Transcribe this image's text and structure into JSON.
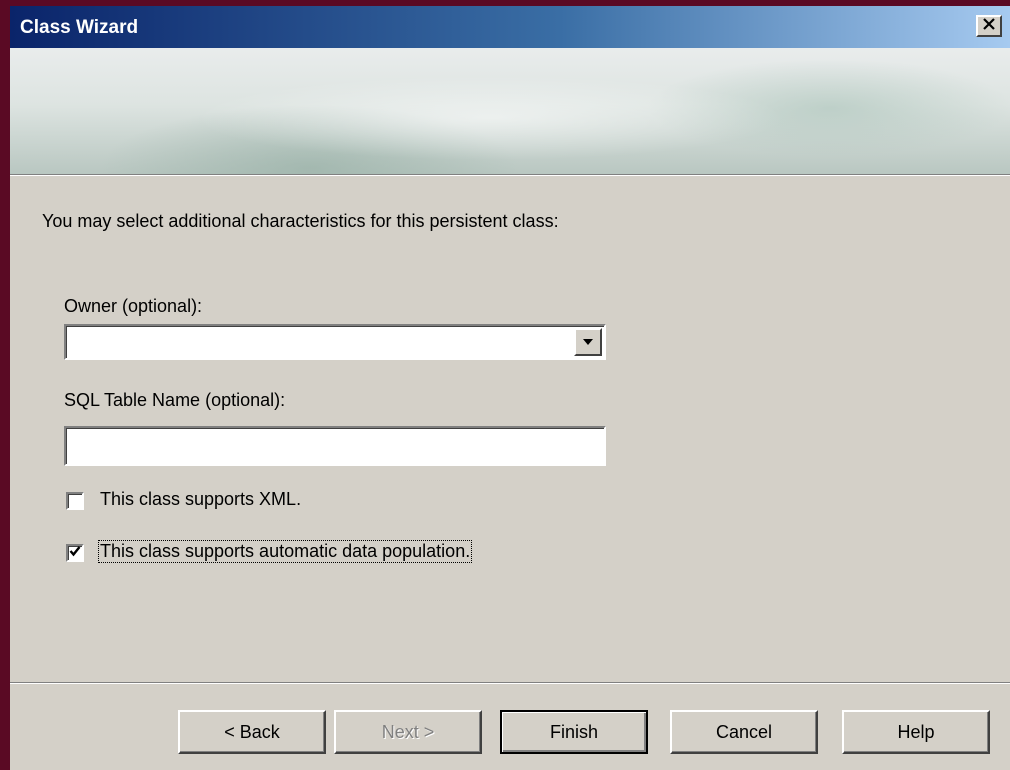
{
  "window": {
    "title": "Class Wizard"
  },
  "intro": "You may select additional characteristics for this persistent class:",
  "owner": {
    "label": "Owner (optional):",
    "value": ""
  },
  "sql_table": {
    "label": "SQL Table Name (optional):",
    "value": ""
  },
  "checkboxes": [
    {
      "label": "This class supports XML.",
      "checked": false
    },
    {
      "label": "This class supports automatic data population.",
      "checked": true
    }
  ],
  "buttons": {
    "back": "< Back",
    "next": "Next >",
    "finish": "Finish",
    "cancel": "Cancel",
    "help": "Help"
  },
  "icons": {
    "close": "close-icon",
    "dropdown": "chevron-down-icon",
    "check": "check-icon"
  }
}
